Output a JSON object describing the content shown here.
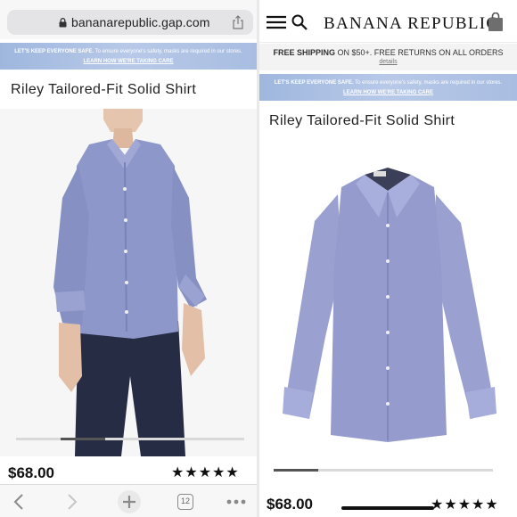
{
  "left": {
    "url": "bananarepublic.gap.com",
    "banner": {
      "bold": "LET'S KEEP EVERYONE SAFE.",
      "text": "To ensure everyone's safety, masks are required in our stores.",
      "link": "LEARN HOW WE'RE TAKING CARE"
    },
    "product_title": "Riley Tailored-Fit Solid Shirt",
    "price": "$68.00",
    "rating_stars": "★★★★★",
    "toolbar": {
      "back_icon": "chevron-left-icon",
      "forward_icon": "chevron-right-icon",
      "new_tab_icon": "plus-icon",
      "tab_count": "12",
      "more_icon": "ellipsis-icon"
    }
  },
  "right": {
    "brand": "BANANA REPUBLIC",
    "shipping": {
      "bold": "FREE SHIPPING",
      "text": "ON $50+. FREE RETURNS ON ALL ORDERS",
      "details": "details"
    },
    "banner": {
      "bold": "LET'S KEEP EVERYONE SAFE.",
      "text": "To ensure everyone's safety, masks are required in our stores.",
      "link": "LEARN HOW WE'RE TAKING CARE"
    },
    "product_title": "Riley Tailored-Fit Solid Shirt",
    "price": "$68.00",
    "rating_stars": "★★★★★"
  },
  "colors": {
    "banner": "#a8bde1",
    "shirt": "#8f97c8",
    "pants": "#252b42"
  },
  "image_carousel": {
    "left_position_fraction": 0.2,
    "right_position_fraction": 0.2
  }
}
